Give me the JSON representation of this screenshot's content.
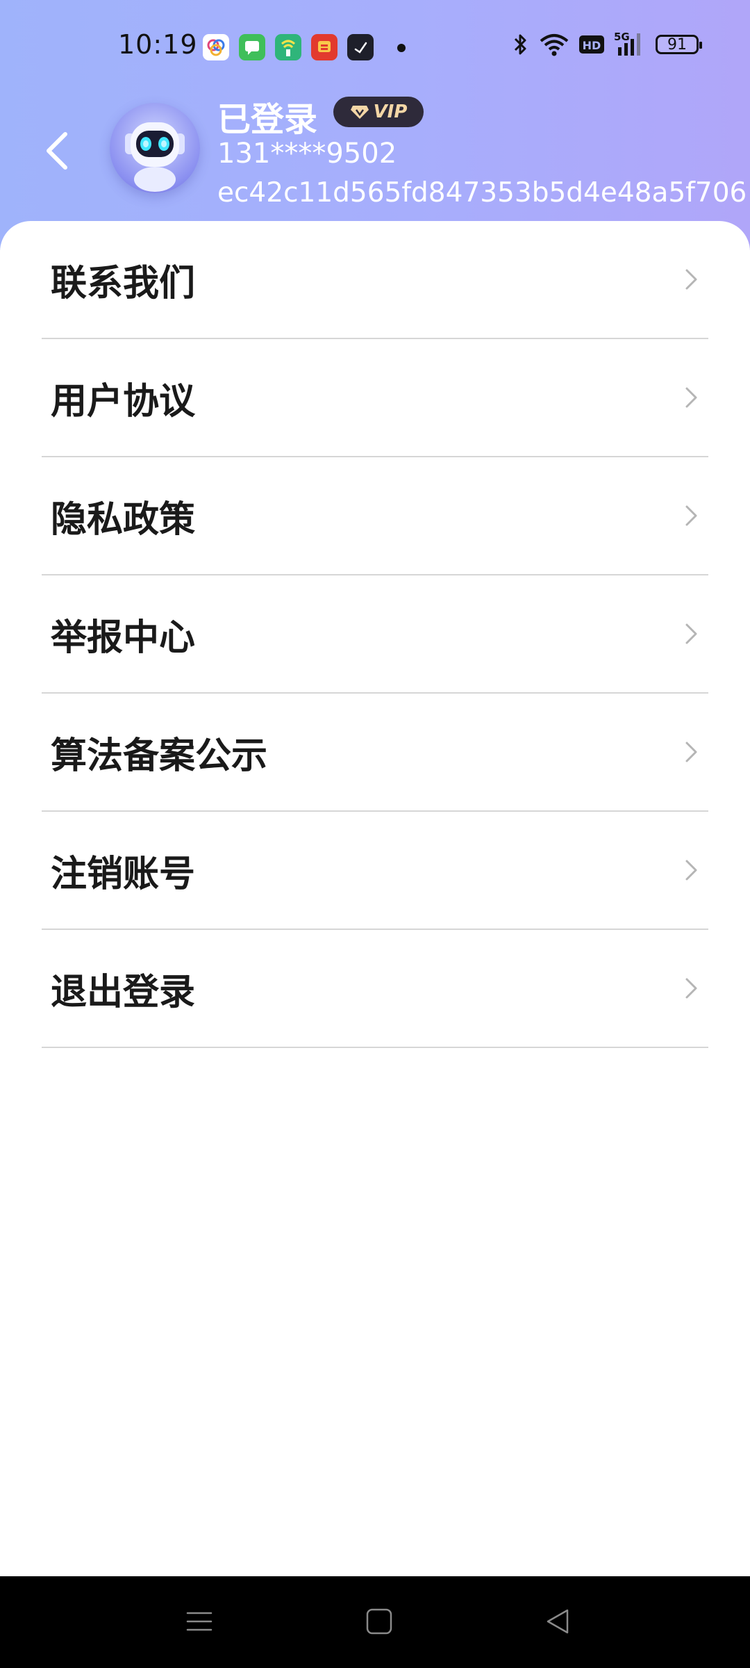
{
  "status_bar": {
    "time": "10:19",
    "battery_level": "91",
    "network": "5G",
    "hd_label": "HD",
    "app_icons": [
      "albums-icon",
      "messages-icon",
      "green-app-icon",
      "red-app-icon",
      "clock-app-icon"
    ],
    "system_icons": [
      "bluetooth-icon",
      "wifi-icon",
      "hd-icon",
      "signal-5g-icon",
      "battery-icon"
    ]
  },
  "profile": {
    "name": "已登录",
    "vip_label": "VIP",
    "phone": "131****9502",
    "user_id": "ec42c11d565fd847353b5d4e48a5f706"
  },
  "menu": {
    "items": [
      {
        "label": "联系我们"
      },
      {
        "label": "用户协议"
      },
      {
        "label": "隐私政策"
      },
      {
        "label": "举报中心"
      },
      {
        "label": "算法备案公示"
      },
      {
        "label": "注销账号"
      },
      {
        "label": "退出登录"
      }
    ]
  },
  "nav_bar": {
    "buttons": [
      "menu-icon",
      "home-icon",
      "back-triangle-icon"
    ]
  },
  "colors": {
    "header_gradient_start": "#9fb3fb",
    "header_gradient_end": "#b0a6f9",
    "vip_badge_bg": "#2e2a3a",
    "vip_text": "#f4d6a6",
    "divider": "#d6d6d6",
    "chevron": "#b5b5b5"
  }
}
